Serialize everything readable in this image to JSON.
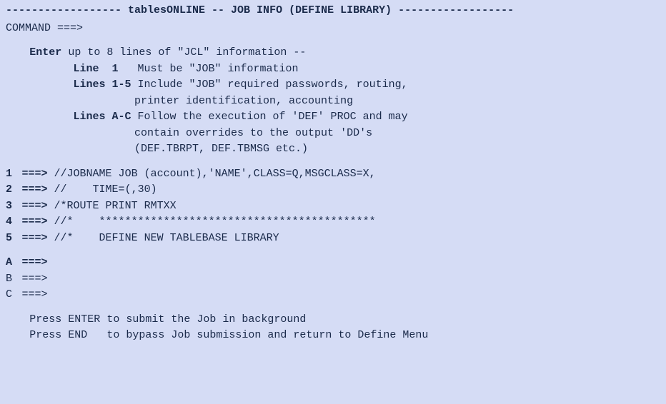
{
  "title": {
    "dash_left": "------------------ ",
    "text": "tablesONLINE -- JOB INFO (DEFINE LIBRARY)",
    "dash_right": " ------------------"
  },
  "command": {
    "label": "COMMAND ===>",
    "value": ""
  },
  "instructions": {
    "enter_label": "Enter",
    "enter_rest": " up to 8 lines of \"JCL\" information --",
    "line1_label": "Line  1",
    "line1_text": "   Must be \"JOB\" information",
    "lines15_label": "Lines 1-5",
    "lines15_text1": " Include \"JOB\" required passwords, routing,",
    "lines15_text2": "printer identification, accounting",
    "linesac_label": "Lines A-C",
    "linesac_text1": " Follow the execution of 'DEF' PROC and may",
    "linesac_text2": "contain overrides to the output 'DD's",
    "linesac_text3": "(DEF.TBRPT, DEF.TBMSG etc.)"
  },
  "arrow": "===>",
  "jcl": [
    {
      "num": "1",
      "bold": true,
      "value": "//JOBNAME JOB (account),'NAME',CLASS=Q,MSGCLASS=X,"
    },
    {
      "num": "2",
      "bold": true,
      "value": "//    TIME=(,30)"
    },
    {
      "num": "3",
      "bold": true,
      "value": "/*ROUTE PRINT RMTXX"
    },
    {
      "num": "4",
      "bold": true,
      "value": "//*    *******************************************"
    },
    {
      "num": "5",
      "bold": true,
      "value": "//*    DEFINE NEW TABLEBASE LIBRARY"
    }
  ],
  "jcl2": [
    {
      "num": "A",
      "bold": true,
      "value": ""
    },
    {
      "num": "B",
      "bold": false,
      "value": ""
    },
    {
      "num": "C",
      "bold": false,
      "value": ""
    }
  ],
  "footer": {
    "line1": "Press ENTER to submit the Job in background",
    "line2": "Press END   to bypass Job submission and return to Define Menu"
  }
}
